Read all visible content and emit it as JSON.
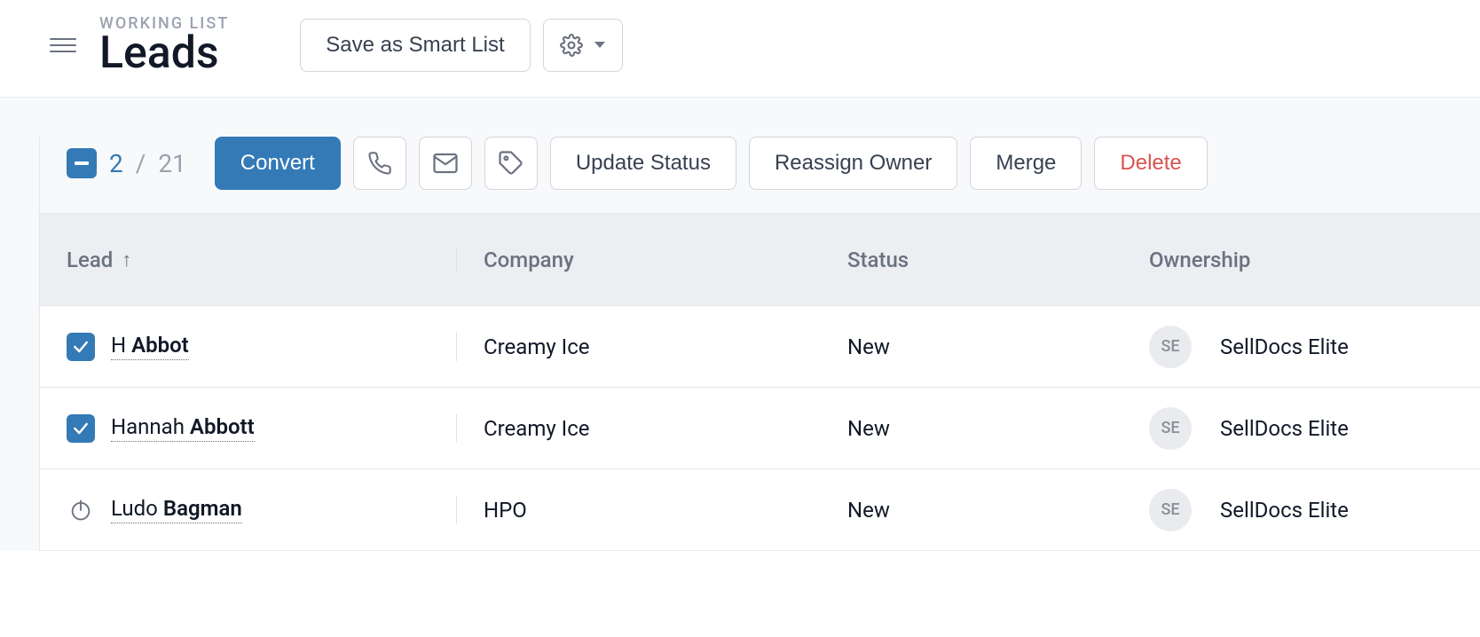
{
  "header": {
    "eyebrow": "WORKING LIST",
    "title": "Leads",
    "save_smart_list_label": "Save as Smart List"
  },
  "toolbar": {
    "selected": "2",
    "total": "21",
    "divider": " / ",
    "convert_label": "Convert",
    "update_status_label": "Update Status",
    "reassign_owner_label": "Reassign Owner",
    "merge_label": "Merge",
    "delete_label": "Delete"
  },
  "table": {
    "columns": {
      "lead": "Lead",
      "company": "Company",
      "status": "Status",
      "ownership": "Ownership"
    },
    "rows": [
      {
        "checked": true,
        "first": "H",
        "last": "Abbot",
        "company": "Creamy Ice",
        "status": "New",
        "owner_initials": "SE",
        "owner_name": "SellDocs Elite"
      },
      {
        "checked": true,
        "first": "Hannah",
        "last": "Abbott",
        "company": "Creamy Ice",
        "status": "New",
        "owner_initials": "SE",
        "owner_name": "SellDocs Elite"
      },
      {
        "checked": false,
        "first": "Ludo",
        "last": "Bagman",
        "company": "HPO",
        "status": "New",
        "owner_initials": "SE",
        "owner_name": "SellDocs Elite"
      }
    ]
  }
}
